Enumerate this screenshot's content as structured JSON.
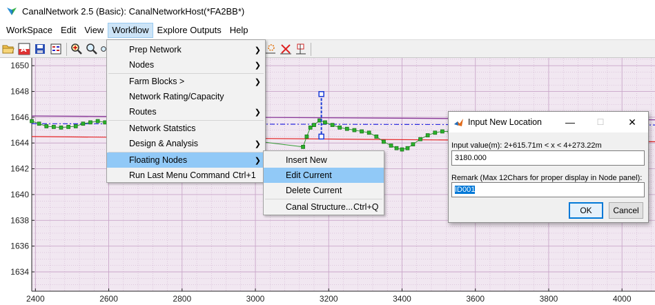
{
  "window": {
    "title": "CanalNetwork 2.5  (Basic): CanalNetworkHost(*FA2BB*)"
  },
  "menubar": {
    "items": [
      "WorkSpace",
      "Edit",
      "View",
      "Workflow",
      "Explore Outputs",
      "Help"
    ],
    "active": "Workflow"
  },
  "toolbar": {
    "icons": [
      "open-folder-icon",
      "font-icon",
      "save-icon",
      "grid-icon",
      "zoom-in-icon",
      "zoom-icon",
      "pan-icon",
      "star-icon",
      "delete-marker-icon",
      "flag-icon"
    ]
  },
  "workflow_menu": {
    "items": [
      {
        "label": "Prep Network",
        "submenu": true
      },
      {
        "label": "Nodes",
        "submenu": true
      },
      {
        "label": "Farm Blocks >",
        "submenu": true
      },
      {
        "label": "Network Rating/Capacity",
        "submenu": false
      },
      {
        "label": "Routes",
        "submenu": true
      },
      {
        "label": "Network Statstics",
        "submenu": false
      },
      {
        "label": "Design & Analysis",
        "submenu": true
      },
      {
        "label": "Floating Nodes",
        "submenu": true
      },
      {
        "label": "Run Last Menu Command",
        "shortcut": "Ctrl+1",
        "submenu": false
      }
    ],
    "highlighted": "Floating Nodes"
  },
  "floating_nodes_menu": {
    "items": [
      {
        "label": "Insert New"
      },
      {
        "label": "Edit Current"
      },
      {
        "label": "Delete Current"
      },
      {
        "label": "Canal Structure...",
        "shortcut": "Ctrl+Q"
      }
    ],
    "highlighted": "Edit Current"
  },
  "dialog": {
    "title": "Input New Location",
    "range_label": "Input value(m): 2+615.71m < x < 4+273.22m",
    "value": "3180.000",
    "remark_label": "Remark (Max 12Chars for proper display in Node panel):",
    "remark_value": "ID001",
    "ok_label": "OK",
    "cancel_label": "Cancel",
    "minimize_glyph": "—",
    "maximize_glyph": "☐",
    "close_glyph": "✕"
  },
  "colors": {
    "plot_bg": "#f1e7f1",
    "grid": "#c9a6c9",
    "profile_line": "#2e9b2e",
    "profile_marker": "#2bb12b",
    "blue_dashdot": "#2a2ae0",
    "red_line": "#e52222",
    "purple_line": "#8a3a9a",
    "menu_highlight": "#91c9f7"
  },
  "chart_data": {
    "type": "line",
    "yticks": [
      "1650",
      "1648",
      "1646",
      "1644",
      "1642",
      "1640",
      "1638",
      "1636",
      "1634"
    ],
    "xticks": [
      "2400",
      "2600",
      "2800",
      "3000",
      "3200",
      "3400",
      "3600",
      "3800",
      "4000"
    ],
    "xlim": [
      2390,
      4090
    ],
    "ylim": [
      1632.5,
      1650.6
    ],
    "grid": true,
    "series": [
      {
        "style": "green-line-square-markers",
        "x": [
          2390,
          2410,
          2430,
          2450,
          2470,
          2490,
          2510,
          2530,
          2550,
          2570,
          2590,
          2610,
          3130,
          3140,
          3150,
          3160,
          3175,
          3190,
          3210,
          3230,
          3250,
          3270,
          3290,
          3310,
          3330,
          3350,
          3370,
          3385,
          3400,
          3415,
          3430,
          3450,
          3470,
          3490,
          3510,
          3530,
          3550,
          3570,
          3590,
          3610,
          3630,
          3650
        ],
        "y": [
          1645.7,
          1645.5,
          1645.3,
          1645.25,
          1645.2,
          1645.25,
          1645.3,
          1645.5,
          1645.6,
          1645.7,
          1645.6,
          1645.5,
          1643.7,
          1644.5,
          1645.2,
          1645.4,
          1645.75,
          1645.6,
          1645.4,
          1645.2,
          1645.1,
          1645.0,
          1644.9,
          1644.8,
          1644.5,
          1644.1,
          1643.8,
          1643.6,
          1643.5,
          1643.6,
          1643.9,
          1644.3,
          1644.6,
          1644.8,
          1644.9,
          1644.9,
          1644.8,
          1644.7,
          1644.6,
          1644.6,
          1644.6,
          1644.6
        ]
      },
      {
        "style": "purple-line",
        "x": [
          2390,
          4090
        ],
        "y": [
          1646.1,
          1645.8
        ]
      },
      {
        "style": "blue-dashdot",
        "x": [
          2390,
          4090
        ],
        "y": [
          1645.5,
          1645.4
        ]
      },
      {
        "style": "red-line",
        "x": [
          2390,
          4090
        ],
        "y": [
          1644.5,
          1644.1
        ]
      }
    ],
    "floating_node": {
      "x": 3180,
      "y_top": 1647.8,
      "y_bottom": 1644.5
    }
  }
}
